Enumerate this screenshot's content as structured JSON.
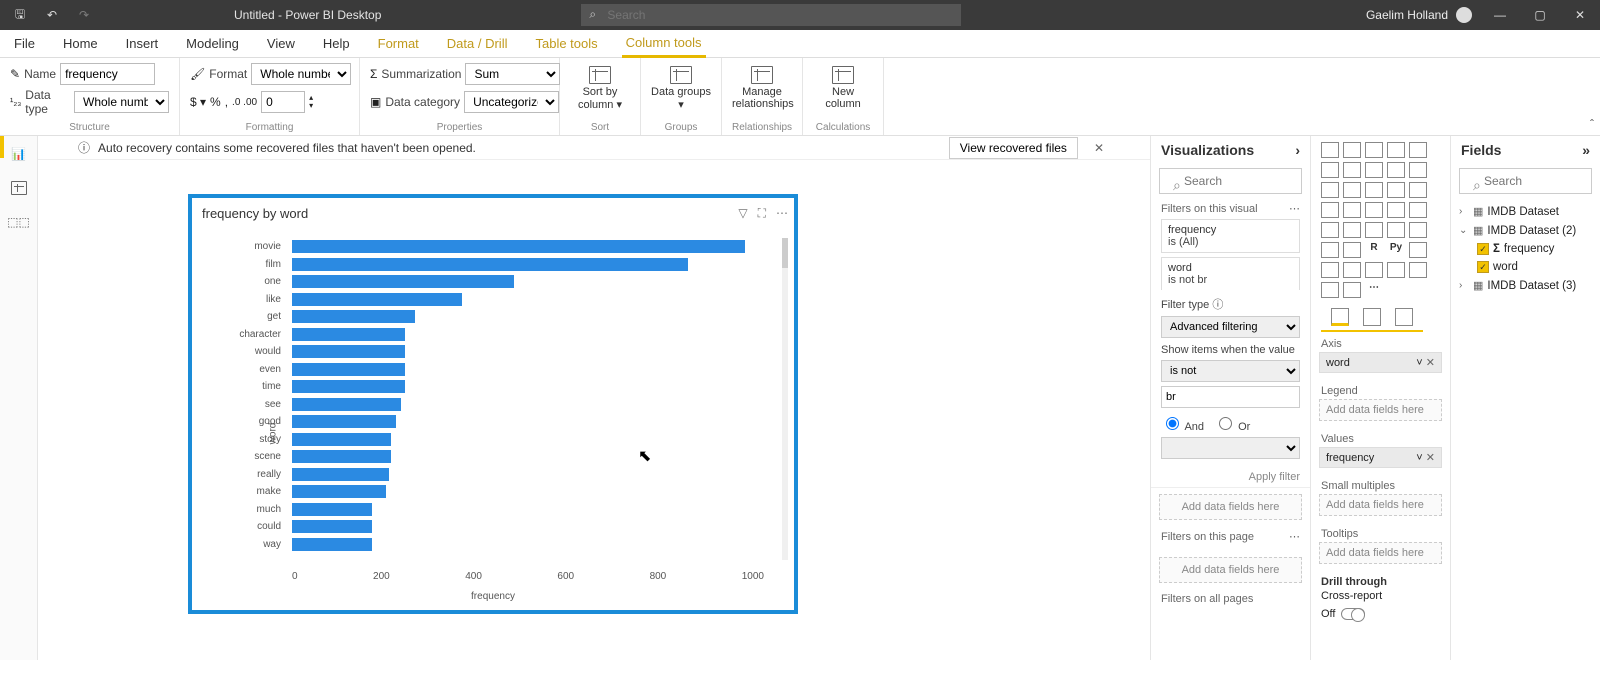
{
  "titlebar": {
    "title": "Untitled - Power BI Desktop",
    "search_placeholder": "Search",
    "user": "Gaelim Holland"
  },
  "menu": {
    "tabs": [
      "File",
      "Home",
      "Insert",
      "Modeling",
      "View",
      "Help",
      "Format",
      "Data / Drill",
      "Table tools",
      "Column tools"
    ],
    "active": "Column tools",
    "highlighted": [
      "Format",
      "Data / Drill",
      "Table tools",
      "Column tools"
    ]
  },
  "ribbon": {
    "structure": {
      "name_label": "Name",
      "name_value": "frequency",
      "type_label": "Data type",
      "type_value": "Whole number",
      "caption": "Structure"
    },
    "formatting": {
      "format_label": "Format",
      "format_value": "Whole number",
      "decimals_value": "0",
      "caption": "Formatting"
    },
    "properties": {
      "summ_label": "Summarization",
      "summ_value": "Sum",
      "cat_label": "Data category",
      "cat_value": "Uncategorized",
      "caption": "Properties"
    },
    "sort": {
      "label": "Sort by column",
      "caption": "Sort"
    },
    "groups": {
      "label": "Data groups",
      "caption": "Groups"
    },
    "rel": {
      "label": "Manage relationships",
      "caption": "Relationships"
    },
    "calc": {
      "label": "New column",
      "caption": "Calculations"
    }
  },
  "infobar": {
    "msg": "Auto recovery contains some recovered files that haven't been opened.",
    "button": "View recovered files"
  },
  "chart_data": {
    "type": "bar",
    "orientation": "horizontal",
    "title": "frequency by word",
    "xlabel": "frequency",
    "ylabel": "word",
    "xlim": [
      0,
      1000
    ],
    "xticks": [
      0,
      200,
      400,
      600,
      800,
      1000
    ],
    "categories": [
      "movie",
      "film",
      "one",
      "like",
      "get",
      "character",
      "would",
      "even",
      "time",
      "see",
      "good",
      "story",
      "scene",
      "really",
      "make",
      "much",
      "could",
      "way"
    ],
    "values": [
      960,
      840,
      470,
      360,
      260,
      240,
      240,
      240,
      240,
      230,
      220,
      210,
      210,
      205,
      200,
      170,
      170,
      170
    ]
  },
  "viz": {
    "header": "Visualizations",
    "search_placeholder": "Search",
    "filters_visual_label": "Filters on this visual",
    "filter1_field": "frequency",
    "filter1_state": "is (All)",
    "filter2_field": "word",
    "filter2_state": "is not br",
    "filter_type_label": "Filter type",
    "filter_type_value": "Advanced filtering",
    "show_items_label": "Show items when the value",
    "condition1": "is not",
    "condition1_value": "br",
    "and_label": "And",
    "or_label": "Or",
    "apply": "Apply filter",
    "add_well": "Add data fields here",
    "filters_page_label": "Filters on this page",
    "filters_all_label": "Filters on all pages"
  },
  "wells": {
    "axis_label": "Axis",
    "axis_value": "word",
    "legend_label": "Legend",
    "legend_empty": "Add data fields here",
    "values_label": "Values",
    "values_value": "frequency",
    "small_label": "Small multiples",
    "small_empty": "Add data fields here",
    "tooltips_label": "Tooltips",
    "tooltips_empty": "Add data fields here",
    "drill_label": "Drill through",
    "cross_label": "Cross-report",
    "cross_state": "Off"
  },
  "fields": {
    "header": "Fields",
    "search_placeholder": "Search",
    "tables": [
      {
        "name": "IMDB Dataset",
        "expanded": false
      },
      {
        "name": "IMDB Dataset (2)",
        "expanded": true,
        "selected_container": true,
        "fields": [
          {
            "name": "frequency",
            "checked": true,
            "sigma": true
          },
          {
            "name": "word",
            "checked": true
          }
        ]
      },
      {
        "name": "IMDB Dataset (3)",
        "expanded": false
      }
    ]
  }
}
